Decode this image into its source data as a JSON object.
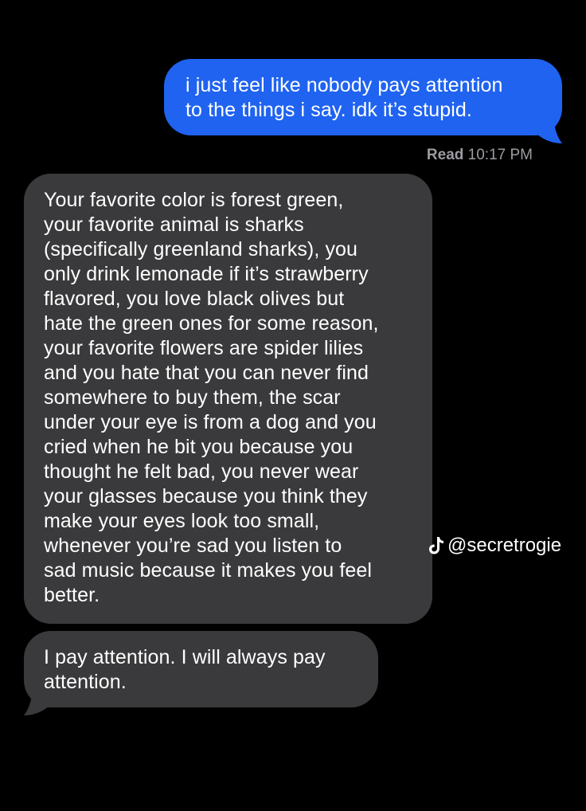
{
  "conversation": {
    "messages": [
      {
        "direction": "sent",
        "text": "i just feel like nobody pays attention\nto the things i say. idk it’s stupid."
      },
      {
        "direction": "received",
        "text": "Your favorite color is forest green,\nyour favorite animal is sharks\n(specifically greenland sharks), you\nonly drink lemonade if it’s strawberry\nflavored, you love black olives but\nhate the green ones for some reason,\nyour favorite flowers are spider lilies\nand you hate that you can never find\nsomewhere to buy them, the scar\nunder your eye is from a dog and you\ncried when he bit you because you\nthought he felt bad, you never wear\nyour glasses because you think they\nmake your eyes look too small,\nwhenever you’re sad you listen to\nsad music because it makes you feel\nbetter."
      },
      {
        "direction": "received",
        "text": "I pay attention. I will always pay\nattention."
      }
    ],
    "read_receipt": {
      "label": "Read",
      "time": "10:17 PM"
    }
  },
  "watermark": {
    "icon": "tiktok-icon",
    "handle": "@secretrogie"
  },
  "colors": {
    "background": "#000000",
    "sent_bubble": "#1f63f0",
    "received_bubble": "#3a3a3c",
    "receipt_text": "#9b9ba1"
  }
}
